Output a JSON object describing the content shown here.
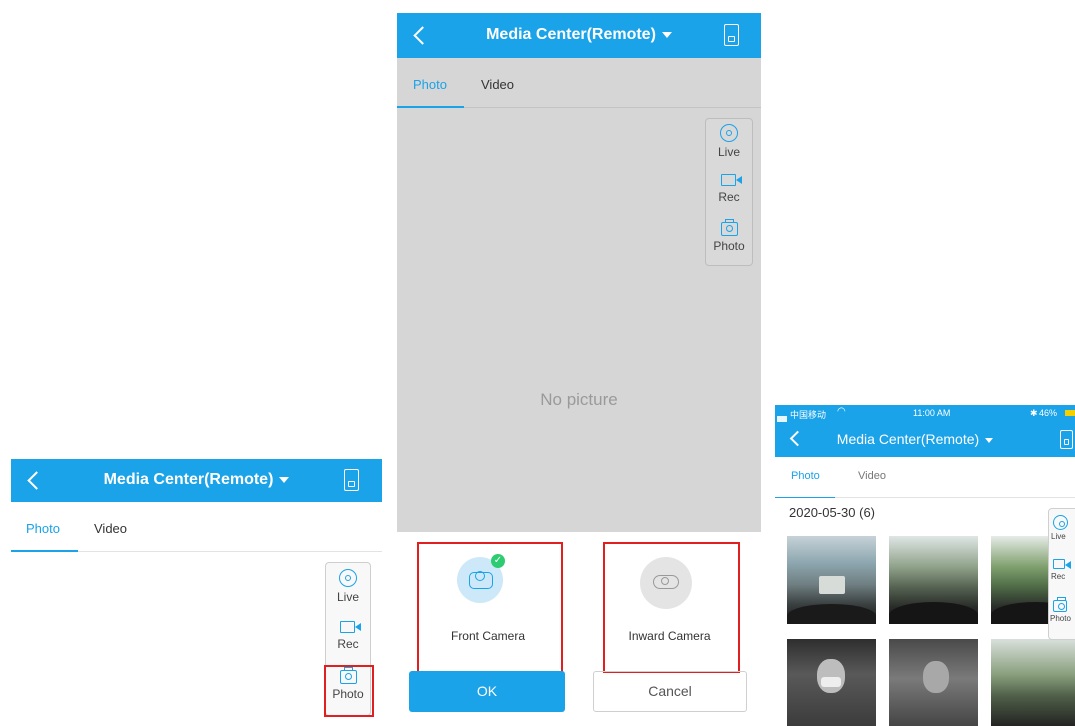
{
  "app": {
    "header_title": "Media Center(Remote)",
    "tabs": [
      "Photo",
      "Video"
    ],
    "fab": {
      "live": "Live",
      "rec": "Rec",
      "photo": "Photo"
    }
  },
  "left_screen": {},
  "middle_screen": {
    "empty_text": "No picture",
    "camera_options": [
      {
        "label": "Front Camera",
        "selected": true
      },
      {
        "label": "Inward Camera",
        "selected": false
      }
    ],
    "ok_label": "OK",
    "cancel_label": "Cancel"
  },
  "right_screen": {
    "status_bar": {
      "carrier": "中国移动",
      "time": "11:00 AM",
      "battery": "46%"
    },
    "date_group": "2020-05-30 (6)"
  },
  "colors": {
    "accent": "#1aa3e8",
    "highlight": "#e02020",
    "check": "#2ecc71"
  }
}
